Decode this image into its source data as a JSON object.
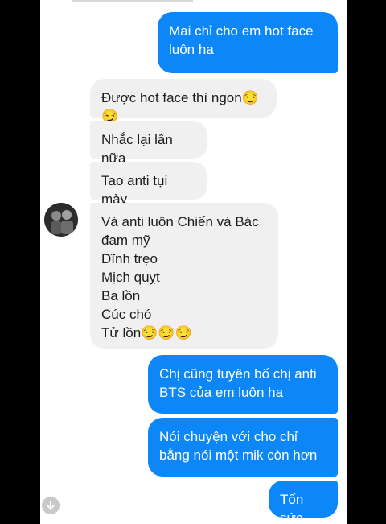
{
  "conversation": {
    "messages": [
      {
        "text": "Mai chỉ cho em hot face\nluôn ha",
        "sender": "me"
      },
      {
        "text": "Được hot face thì ngon😏😏",
        "sender": "other"
      },
      {
        "text": "Nhắc lại lần nữa",
        "sender": "other"
      },
      {
        "text": "Tao anti tụi mày",
        "sender": "other"
      },
      {
        "text": "Và anti luôn Chiến và Bác\nđam mỹ\nDĩnh trẹo\nMịch quỵt\nBa lồn\nCúc chó\nTử lồn😏😏😏",
        "sender": "other"
      },
      {
        "text": "Chị cũng tuyên bố chị anti\nBTS của em luôn ha",
        "sender": "me"
      },
      {
        "text": "Nói chuyện với cho chỉ\nbằng nói một mik còn hơn",
        "sender": "me"
      },
      {
        "text": "Tốn sức",
        "sender": "me"
      }
    ]
  },
  "colors": {
    "outgoing_bubble": "#0d87f7",
    "incoming_bubble": "#f1f0f0",
    "background": "#ffffff"
  },
  "icons": {
    "avatar": "avatar",
    "scroll": "arrow-down-circle-icon"
  }
}
